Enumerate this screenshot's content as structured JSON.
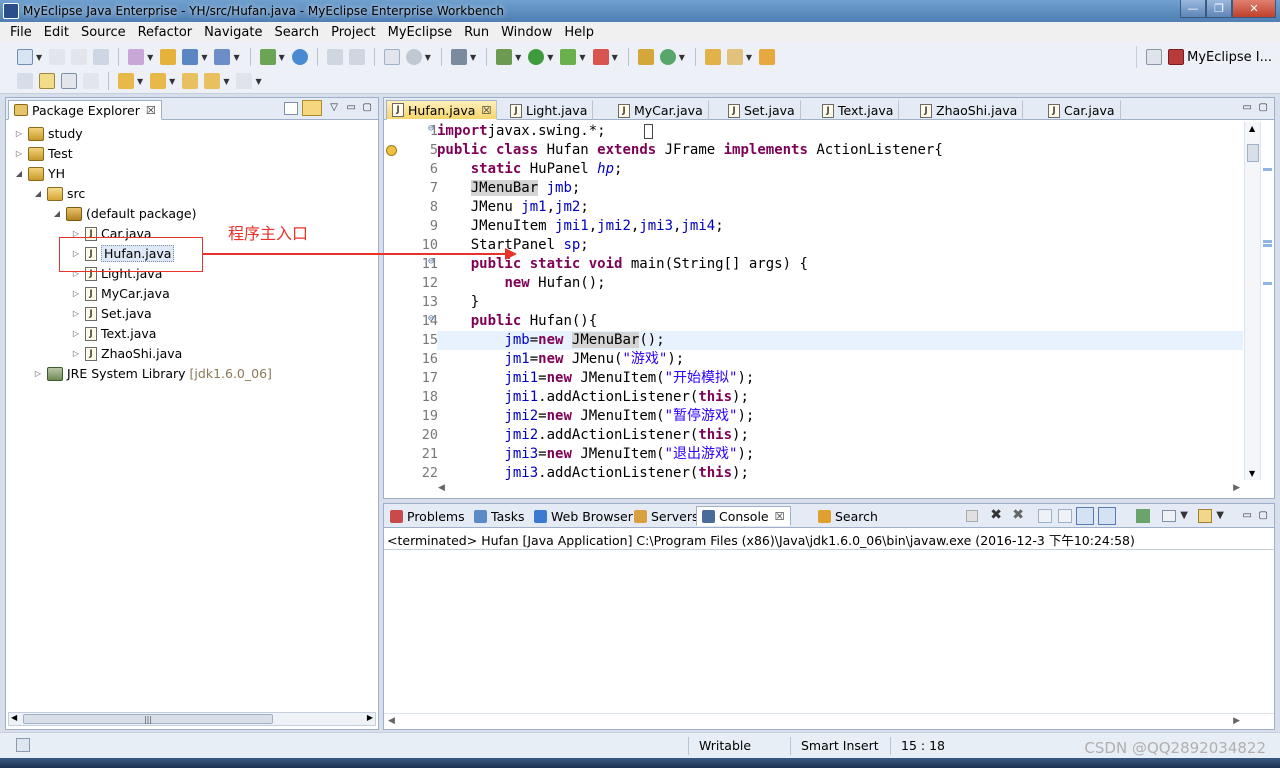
{
  "window": {
    "title": "MyEclipse Java Enterprise - YH/src/Hufan.java - MyEclipse Enterprise Workbench"
  },
  "menu": [
    "File",
    "Edit",
    "Source",
    "Refactor",
    "Navigate",
    "Search",
    "Project",
    "MyEclipse",
    "Run",
    "Window",
    "Help"
  ],
  "perspective": {
    "label": "MyEclipse I..."
  },
  "package_explorer": {
    "title": "Package Explorer",
    "tree": [
      {
        "label": "study",
        "level": 0,
        "expand": "collapsed",
        "icon": "project-icon"
      },
      {
        "label": "Test",
        "level": 0,
        "expand": "collapsed",
        "icon": "project-icon"
      },
      {
        "label": "YH",
        "level": 0,
        "expand": "expanded",
        "icon": "project-icon"
      },
      {
        "label": "src",
        "level": 1,
        "expand": "expanded",
        "icon": "source-folder-icon"
      },
      {
        "label": "(default package)",
        "level": 2,
        "expand": "expanded",
        "icon": "package-icon"
      },
      {
        "label": "Car.java",
        "level": 3,
        "expand": "collapsed",
        "icon": "java-file-icon"
      },
      {
        "label": "Hufan.java",
        "level": 3,
        "expand": "collapsed",
        "icon": "java-file-icon",
        "selected": true
      },
      {
        "label": "Light.java",
        "level": 3,
        "expand": "collapsed",
        "icon": "java-file-icon"
      },
      {
        "label": "MyCar.java",
        "level": 3,
        "expand": "collapsed",
        "icon": "java-file-icon"
      },
      {
        "label": "Set.java",
        "level": 3,
        "expand": "collapsed",
        "icon": "java-file-icon"
      },
      {
        "label": "Text.java",
        "level": 3,
        "expand": "collapsed",
        "icon": "java-file-icon"
      },
      {
        "label": "ZhaoShi.java",
        "level": 3,
        "expand": "collapsed",
        "icon": "java-file-icon"
      },
      {
        "label": "JRE System Library",
        "extra": "[jdk1.6.0_06]",
        "level": 1,
        "expand": "collapsed",
        "icon": "library-icon"
      }
    ]
  },
  "annotation": {
    "text": "程序主入口",
    "color": "#e8322a"
  },
  "editor": {
    "tabs": [
      "Hufan.java",
      "Light.java",
      "MyCar.java",
      "Set.java",
      "Text.java",
      "ZhaoShi.java",
      "Car.java"
    ],
    "active_tab": "Hufan.java",
    "cursor_line": 15,
    "lines": [
      {
        "n": "1",
        "t": [
          [
            "kw",
            "import"
          ],
          [
            "",
            "javax.swing.*;  "
          ]
        ],
        "fold": true
      },
      {
        "n": "5",
        "t": [
          [
            "kw",
            "public class"
          ],
          [
            "",
            " Hufan "
          ],
          [
            "kw",
            "extends"
          ],
          [
            "",
            " JFrame "
          ],
          [
            "kw",
            "implements"
          ],
          [
            "",
            " ActionListener{"
          ]
        ]
      },
      {
        "n": "6",
        "t": [
          [
            "",
            "    "
          ],
          [
            "kw",
            "static"
          ],
          [
            "",
            " HuPanel "
          ],
          [
            "ifld",
            "hp"
          ],
          [
            "",
            ";"
          ]
        ]
      },
      {
        "n": "7",
        "t": [
          [
            "",
            "    "
          ],
          [
            "occ",
            "JMenuBar"
          ],
          [
            "",
            " "
          ],
          [
            "fld",
            "jmb"
          ],
          [
            "",
            ";"
          ]
        ]
      },
      {
        "n": "8",
        "t": [
          [
            "",
            "    JMenu "
          ],
          [
            "fld",
            "jm1"
          ],
          [
            "",
            ","
          ],
          [
            "fld",
            "jm2"
          ],
          [
            "",
            ";"
          ]
        ]
      },
      {
        "n": "9",
        "t": [
          [
            "",
            "    JMenuItem "
          ],
          [
            "fld",
            "jmi1"
          ],
          [
            "",
            ","
          ],
          [
            "fld",
            "jmi2"
          ],
          [
            "",
            ","
          ],
          [
            "fld",
            "jmi3"
          ],
          [
            "",
            ","
          ],
          [
            "fld",
            "jmi4"
          ],
          [
            "",
            ";"
          ]
        ]
      },
      {
        "n": "10",
        "t": [
          [
            "",
            "    StartPanel "
          ],
          [
            "fld",
            "sp"
          ],
          [
            "",
            ";"
          ]
        ]
      },
      {
        "n": "11",
        "t": [
          [
            "",
            "    "
          ],
          [
            "kw",
            "public static void"
          ],
          [
            "",
            " main(String[] args) {"
          ]
        ],
        "fold": true
      },
      {
        "n": "12",
        "t": [
          [
            "",
            "        "
          ],
          [
            "kw",
            "new"
          ],
          [
            "",
            " Hufan();"
          ]
        ]
      },
      {
        "n": "13",
        "t": [
          [
            "",
            "    }"
          ]
        ]
      },
      {
        "n": "14",
        "t": [
          [
            "",
            "    "
          ],
          [
            "kw",
            "public"
          ],
          [
            "",
            " Hufan(){"
          ]
        ],
        "fold": true
      },
      {
        "n": "15",
        "t": [
          [
            "",
            "        "
          ],
          [
            "fld",
            "jmb"
          ],
          [
            "",
            "="
          ],
          [
            "kw",
            "new"
          ],
          [
            "",
            " "
          ],
          [
            "occ",
            "JMenuBar"
          ],
          [
            "",
            "();"
          ]
        ]
      },
      {
        "n": "16",
        "t": [
          [
            "",
            "        "
          ],
          [
            "fld",
            "jm1"
          ],
          [
            "",
            "="
          ],
          [
            "kw",
            "new"
          ],
          [
            "",
            " JMenu("
          ],
          [
            "str",
            "\"游戏\""
          ],
          [
            "",
            ");"
          ]
        ]
      },
      {
        "n": "17",
        "t": [
          [
            "",
            "        "
          ],
          [
            "fld",
            "jmi1"
          ],
          [
            "",
            "="
          ],
          [
            "kw",
            "new"
          ],
          [
            "",
            " JMenuItem("
          ],
          [
            "str",
            "\"开始模拟\""
          ],
          [
            "",
            ");"
          ]
        ]
      },
      {
        "n": "18",
        "t": [
          [
            "",
            "        "
          ],
          [
            "fld",
            "jmi1"
          ],
          [
            "",
            ".addActionListener("
          ],
          [
            "kw",
            "this"
          ],
          [
            "",
            ");"
          ]
        ]
      },
      {
        "n": "19",
        "t": [
          [
            "",
            "        "
          ],
          [
            "fld",
            "jmi2"
          ],
          [
            "",
            "="
          ],
          [
            "kw",
            "new"
          ],
          [
            "",
            " JMenuItem("
          ],
          [
            "str",
            "\"暂停游戏\""
          ],
          [
            "",
            ");"
          ]
        ]
      },
      {
        "n": "20",
        "t": [
          [
            "",
            "        "
          ],
          [
            "fld",
            "jmi2"
          ],
          [
            "",
            ".addActionListener("
          ],
          [
            "kw",
            "this"
          ],
          [
            "",
            ");"
          ]
        ]
      },
      {
        "n": "21",
        "t": [
          [
            "",
            "        "
          ],
          [
            "fld",
            "jmi3"
          ],
          [
            "",
            "="
          ],
          [
            "kw",
            "new"
          ],
          [
            "",
            " JMenuItem("
          ],
          [
            "str",
            "\"退出游戏\""
          ],
          [
            "",
            ");"
          ]
        ]
      },
      {
        "n": "22",
        "t": [
          [
            "",
            "        "
          ],
          [
            "fld",
            "jmi3"
          ],
          [
            "",
            ".addActionListener("
          ],
          [
            "kw",
            "this"
          ],
          [
            "",
            ");"
          ]
        ]
      }
    ]
  },
  "console_view": {
    "tabs": [
      "Problems",
      "Tasks",
      "Web Browser",
      "Servers",
      "Console",
      "Search"
    ],
    "active_tab": "Console",
    "info": "<terminated> Hufan [Java Application] C:\\Program Files (x86)\\Java\\jdk1.6.0_06\\bin\\javaw.exe (2016-12-3 下午10:24:58)"
  },
  "status_bar": {
    "writable": "Writable",
    "insert_mode": "Smart Insert",
    "position": "15 : 18"
  },
  "watermark": "CSDN @QQ2892034822"
}
